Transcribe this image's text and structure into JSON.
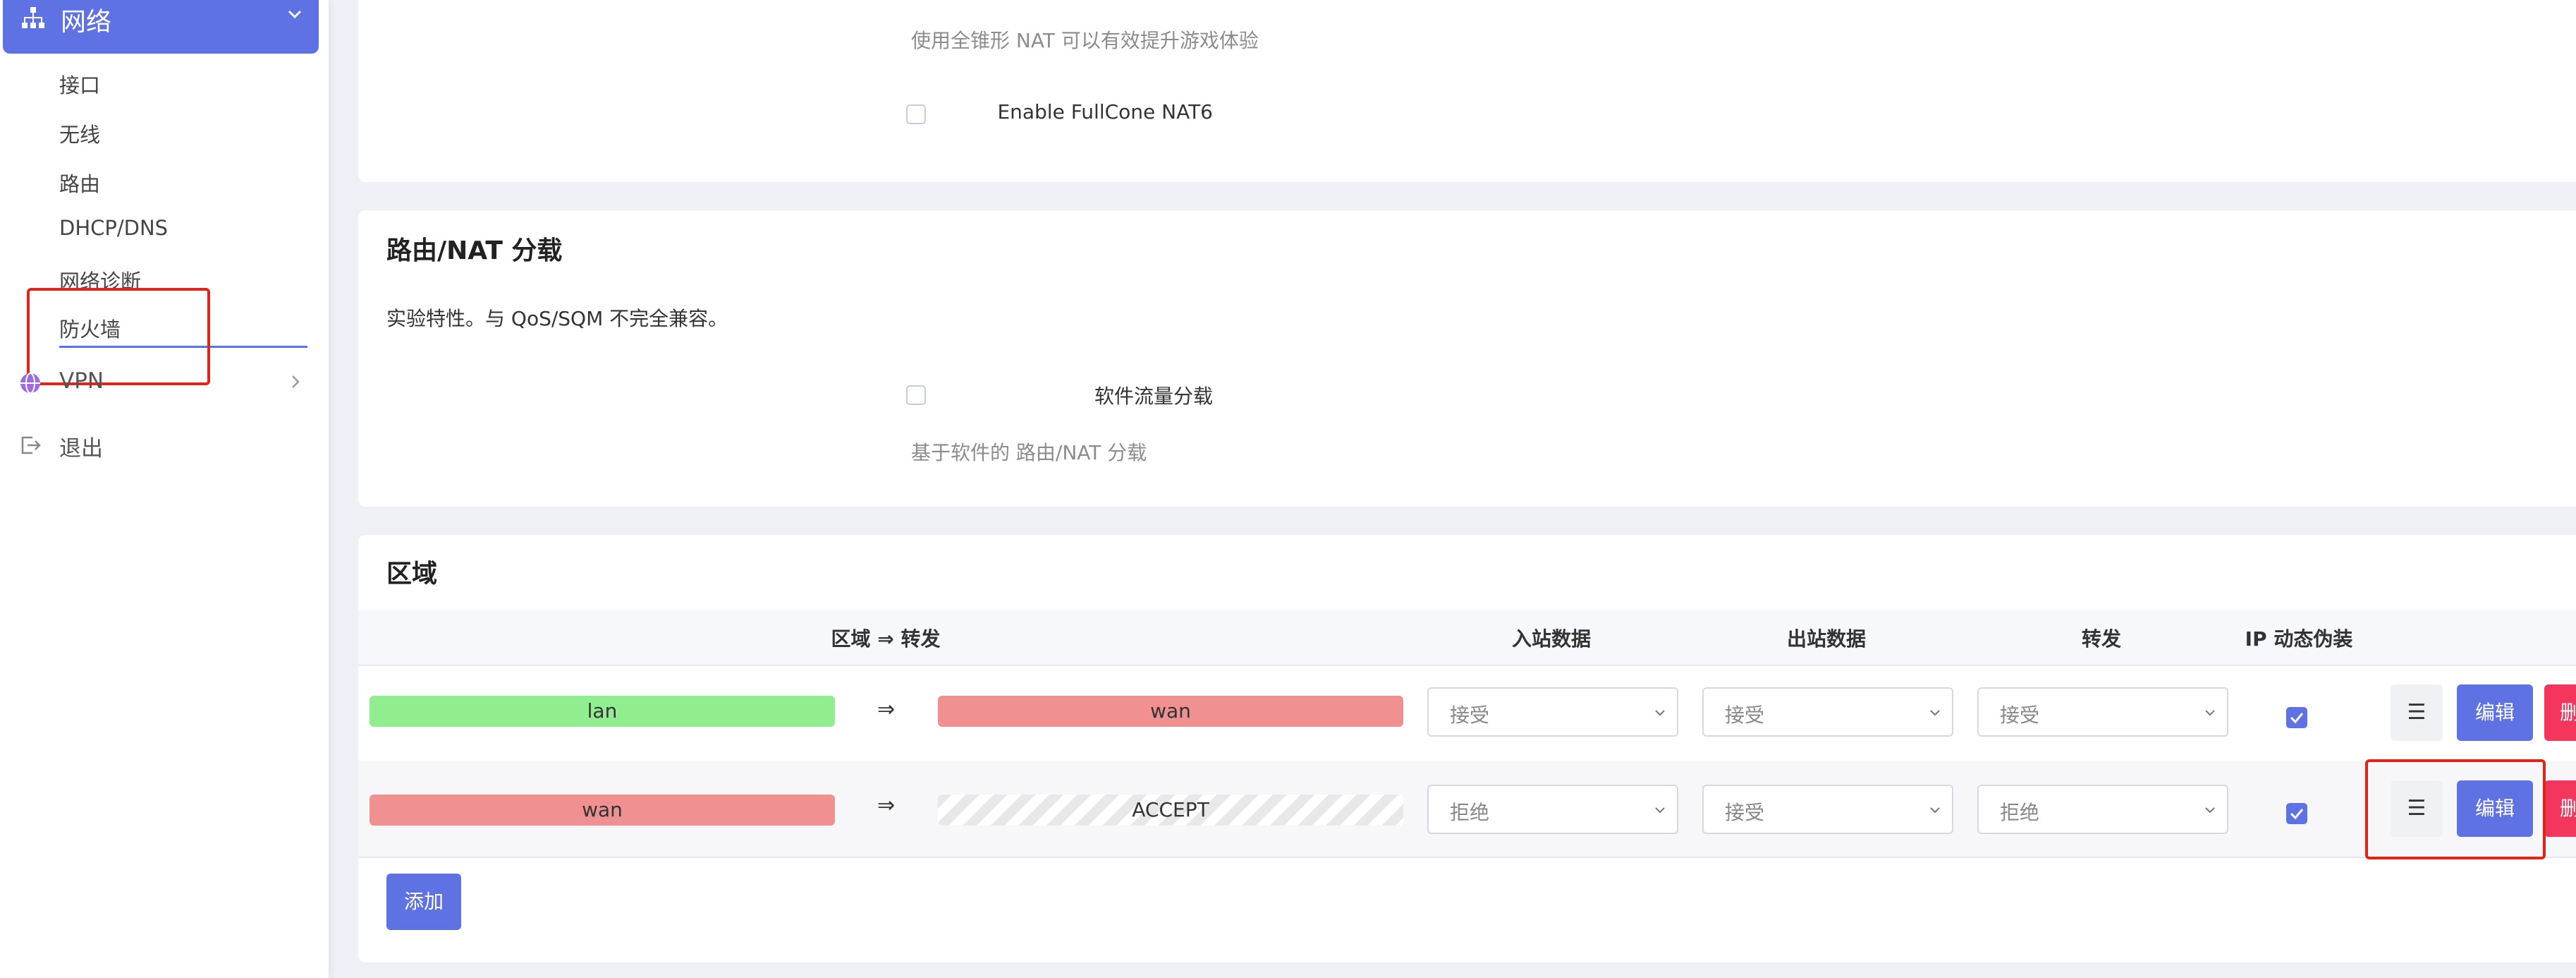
{
  "sidebar": {
    "active_section": "网络",
    "subitems": [
      "接口",
      "无线",
      "路由",
      "DHCP/DNS",
      "网络诊断",
      "防火墙"
    ],
    "vpn_label": "VPN",
    "logout_label": "退出",
    "accent_color": "#5e72e4"
  },
  "nat_card": {
    "fullcone_hint": "使用全锥形 NAT 可以有效提升游戏体验",
    "fullcone6_label": "Enable FullCone NAT6"
  },
  "offload_card": {
    "title": "路由/NAT 分载",
    "description": "实验特性。与 QoS/SQM 不完全兼容。",
    "software_offload_label": "软件流量分载",
    "software_offload_hint": "基于软件的 路由/NAT 分载"
  },
  "zones_card": {
    "title": "区域",
    "headers": {
      "zone_forward": "区域 ⇒ 转发",
      "input": "入站数据",
      "output": "出站数据",
      "forward": "转发",
      "masquerade": "IP 动态伪装"
    },
    "rows": [
      {
        "zone": "lan",
        "arrow": "⇒",
        "target": "wan",
        "input": "接受",
        "output": "接受",
        "forward": "接受",
        "masq": true
      },
      {
        "zone": "wan",
        "arrow": "⇒",
        "target": "ACCEPT",
        "input": "拒绝",
        "output": "接受",
        "forward": "拒绝",
        "masq": true
      }
    ],
    "menu_button": "☰",
    "edit_button": "编辑",
    "delete_button": "删除",
    "add_button": "添加",
    "colors": {
      "lan": "#90ee90",
      "wan": "#f09090"
    }
  }
}
